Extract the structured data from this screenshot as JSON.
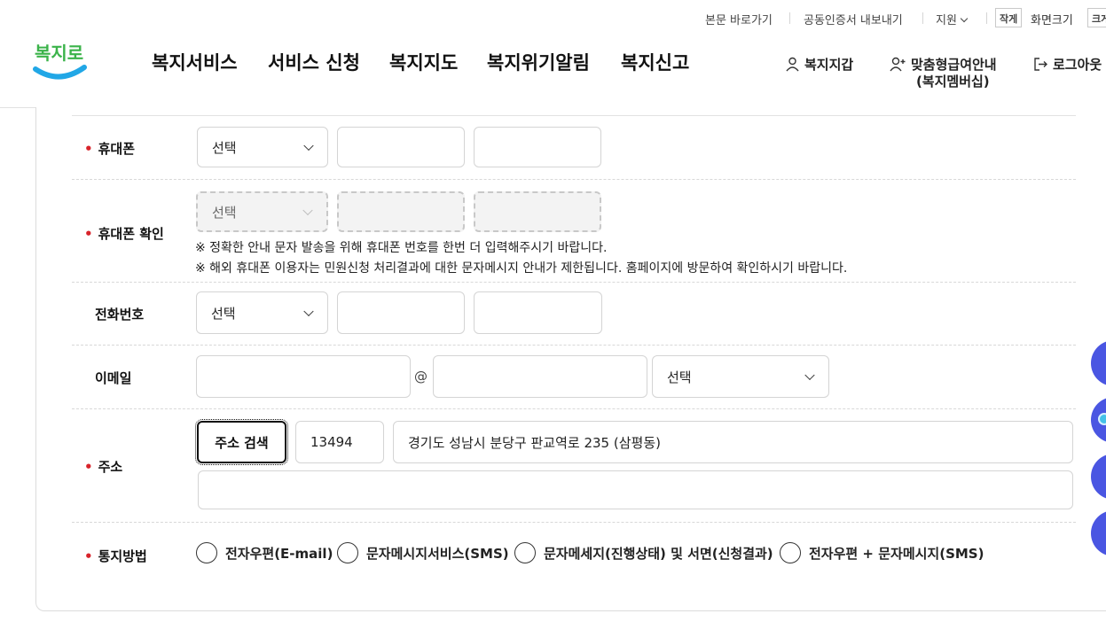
{
  "utility": {
    "skip": "본문 바로가기",
    "cert": "공동인증서 내보내기",
    "support": "지원",
    "font_small": "작게",
    "font_size_label": "화면크기",
    "font_large": "크게"
  },
  "logo": {
    "text": "복지로"
  },
  "gnb": [
    "복지서비스",
    "서비스 신청",
    "복지지도",
    "복지위기알림",
    "복지신고"
  ],
  "header_util": {
    "wallet": "복지지갑",
    "membership_line1": "맞춤형급여안내",
    "membership_line2": "(복지멤버십)",
    "logout": "로그아웃"
  },
  "colors": {
    "required": "#d8232a",
    "accent": "#4a56e2"
  },
  "form": {
    "mobile": {
      "label": "휴대폰",
      "required": true,
      "select": "선택",
      "part2": "",
      "part3": ""
    },
    "mobile_confirm": {
      "label": "휴대폰 확인",
      "required": true,
      "select": "선택",
      "disabled": true,
      "note1": "※ 정확한 안내 문자 발송을 위해 휴대폰 번호를 한번 더 입력해주시기 바랍니다.",
      "note2": "※ 해외 휴대폰 이용자는 민원신청 처리결과에 대한 문자메시지 안내가 제한됩니다. 홈페이지에 방문하여 확인하시기 바랍니다."
    },
    "phone": {
      "label": "전화번호",
      "required": false,
      "select": "선택"
    },
    "email": {
      "label": "이메일",
      "required": false,
      "at": "@",
      "domain_select": "선택"
    },
    "address": {
      "label": "주소",
      "required": true,
      "search_button": "주소 검색",
      "zipcode": "13494",
      "road": "경기도 성남시 분당구 판교역로 235 (삼평동)",
      "detail": ""
    },
    "notify": {
      "label": "통지방법",
      "required": true,
      "options": [
        "전자우편(E-mail)",
        "문자메시지서비스(SMS)",
        "문자메세지(진행상태) 및 서면(신청결과)",
        "전자우편 + 문자메시지(SMS)"
      ]
    }
  }
}
